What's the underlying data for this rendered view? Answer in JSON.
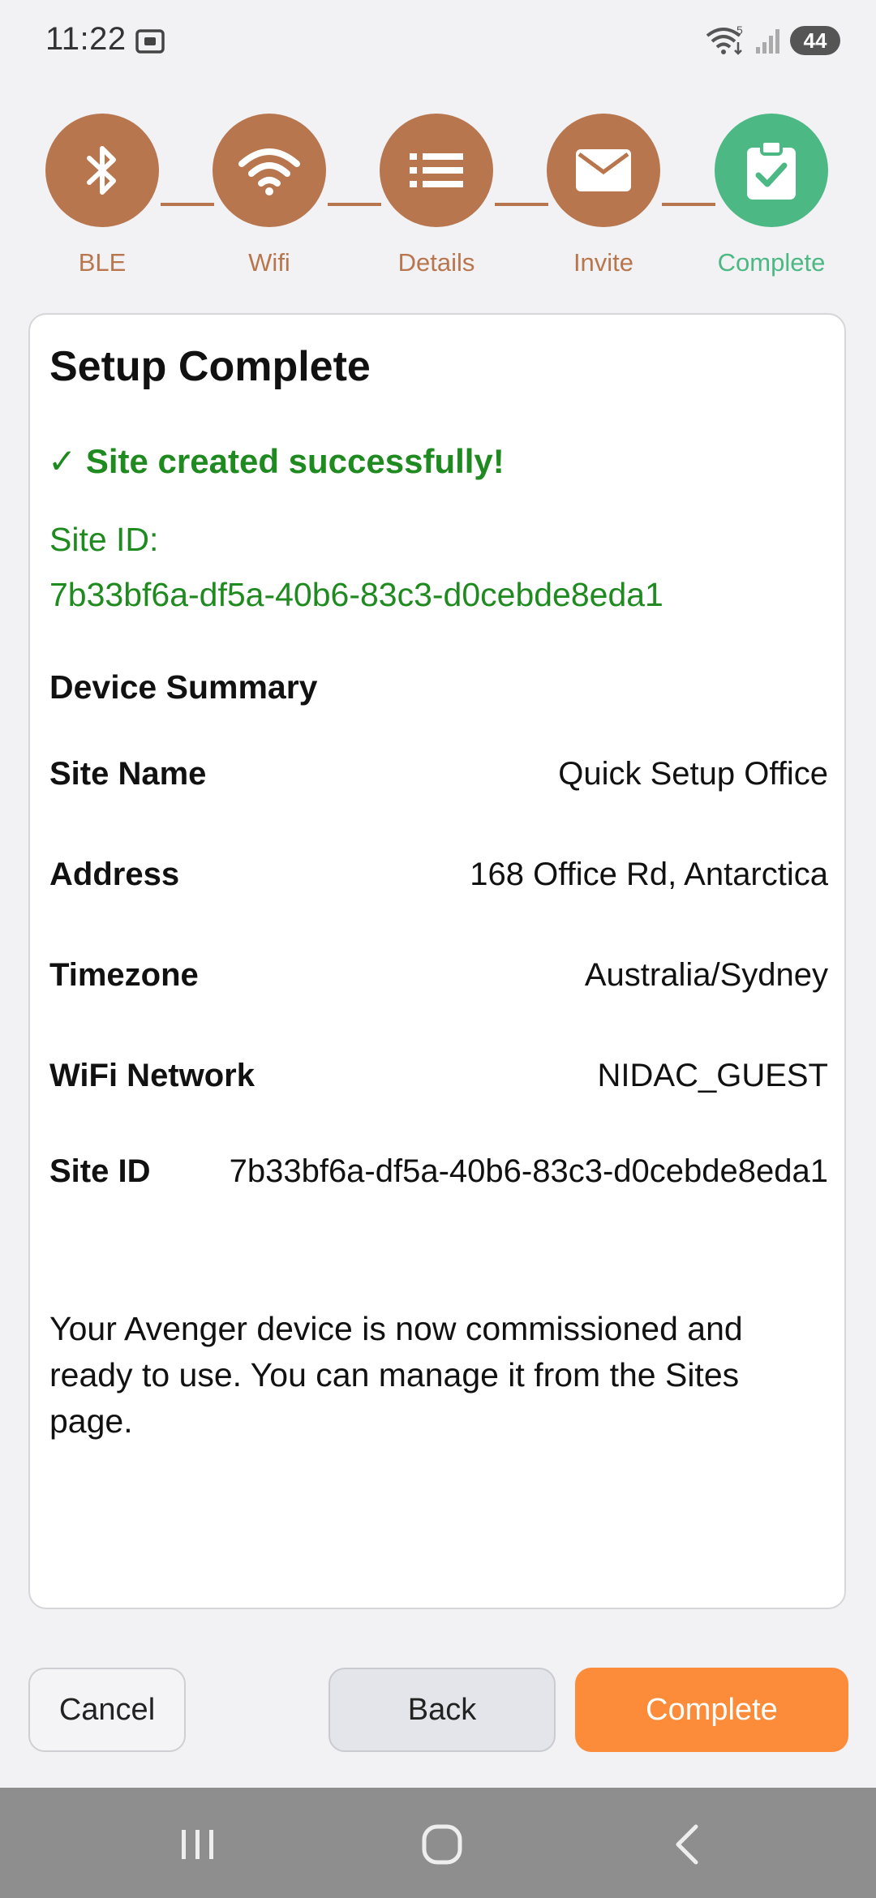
{
  "status_bar": {
    "time": "11:22",
    "battery": "44",
    "wifi_badge": "5"
  },
  "steps": [
    {
      "label": "BLE",
      "icon": "bluetooth-icon",
      "state": "completed"
    },
    {
      "label": "Wifi",
      "icon": "wifi-icon",
      "state": "completed"
    },
    {
      "label": "Details",
      "icon": "list-icon",
      "state": "completed"
    },
    {
      "label": "Invite",
      "icon": "envelope-icon",
      "state": "completed"
    },
    {
      "label": "Complete",
      "icon": "clipboard-check-icon",
      "state": "current"
    }
  ],
  "card": {
    "title": "Setup Complete",
    "success_message": "✓ Site created successfully!",
    "site_id_label": "Site ID:",
    "site_id_value": "7b33bf6a-df5a-40b6-83c3-d0cebde8eda1",
    "summary_heading": "Device Summary",
    "summary": [
      {
        "key": "Site Name",
        "value": "Quick Setup Office"
      },
      {
        "key": "Address",
        "value": "168 Office Rd, Antarctica"
      },
      {
        "key": "Timezone",
        "value": "Australia/Sydney"
      },
      {
        "key": "WiFi Network",
        "value": "NIDAC_GUEST"
      },
      {
        "key": "Site ID",
        "value": "7b33bf6a-df5a-40b6-83c3-d0cebde8eda1"
      }
    ],
    "note": "Your Avenger device is now commissioned and ready to use. You can manage it from the Sites page."
  },
  "buttons": {
    "cancel": "Cancel",
    "back": "Back",
    "complete": "Complete"
  },
  "colors": {
    "step_active": "#b8764e",
    "step_done": "#4cb884",
    "success": "#1f8a1f",
    "primary": "#fd8c3a"
  }
}
